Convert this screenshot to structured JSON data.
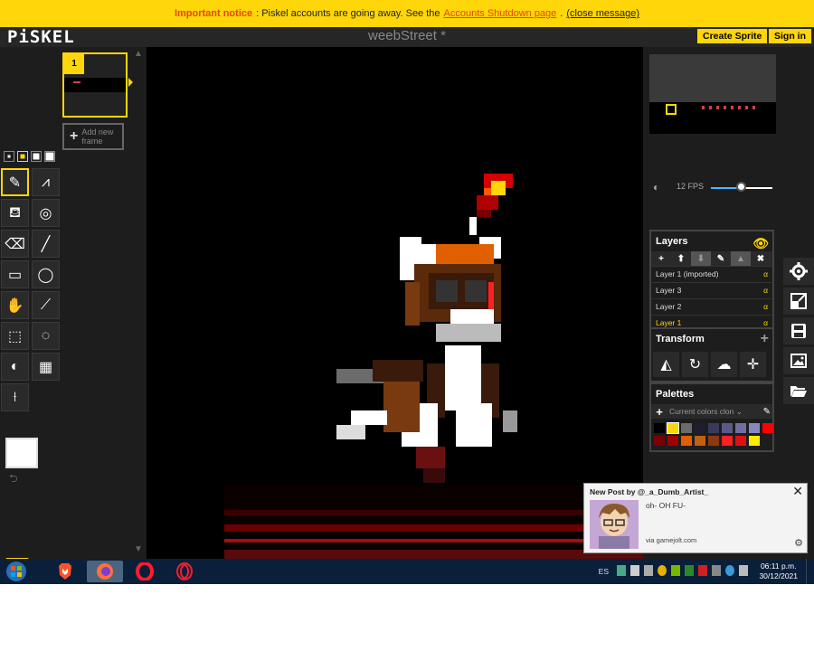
{
  "notice": {
    "important": "Important notice",
    "text": ": Piskel accounts are going away. See the",
    "link": "Accounts Shutdown page",
    "sep": ".",
    "close": "(close message)"
  },
  "header": {
    "logo": "PiSKEL",
    "title": "weebStreet *",
    "create_label": "Create Sprite",
    "signin_label": "Sign in"
  },
  "frames": {
    "current_number": "1",
    "add_label_1": "Add new",
    "add_label_2": "frame"
  },
  "tools": [
    "pen-tool",
    "vertical-mirror-pen-tool",
    "paint-bucket-tool",
    "paint-same-color-tool",
    "eraser-tool",
    "stroke-tool",
    "rectangle-tool",
    "circle-tool",
    "move-tool",
    "shape-selection-tool",
    "rectangle-selection-tool",
    "lasso-selection-tool",
    "lighten-tool",
    "dithering-tool",
    "color-picker-tool"
  ],
  "colors": {
    "primary": "#ffffff",
    "accent": "#ffd60a"
  },
  "preview": {
    "fps_label": "12 FPS",
    "fps": 12
  },
  "layers": {
    "title": "Layers",
    "items": [
      {
        "name": "Layer 1 (imported)",
        "alpha": "α"
      },
      {
        "name": "Layer 3",
        "alpha": "α"
      },
      {
        "name": "Layer 2",
        "alpha": "α"
      },
      {
        "name": "Layer 1",
        "alpha": "α"
      }
    ]
  },
  "transform": {
    "title": "Transform"
  },
  "palettes": {
    "title": "Palettes",
    "selected": "Current colors clon ⌄",
    "swatches": [
      "#000000",
      "#ffd60a",
      "#6b6b6b",
      "#1e1e2e",
      "#3a3a5a",
      "#5a5a8a",
      "#7070a0",
      "#8888c0",
      "#ff0000",
      "#7a0000",
      "#a00000",
      "#e06000",
      "#c06010",
      "#8b3a10",
      "#ff2020",
      "#e01010",
      "#ffea00"
    ]
  },
  "taskbar": {
    "lang": "ES",
    "time": "06:11 p.m.",
    "date": "30/12/2021"
  },
  "notification": {
    "title": "New Post by @_a_Dumb_Artist_",
    "message": "oh- OH FU-",
    "via": "via gamejolt.com"
  }
}
